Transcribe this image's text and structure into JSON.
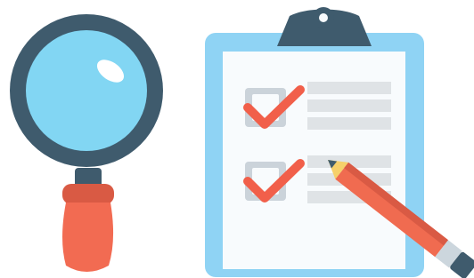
{
  "illustration": {
    "magnifier": {
      "icon": "magnifying-glass"
    },
    "clipboard": {
      "icon": "clipboard",
      "checkboxes": [
        {
          "icon": "checkmark",
          "checked": true
        },
        {
          "icon": "checkmark",
          "checked": true
        }
      ]
    },
    "pencil": {
      "icon": "pencil"
    }
  },
  "colors": {
    "background": "#ffffff",
    "lens_fill": "#82d6f3",
    "frame_dark": "#3f5b6d",
    "handle_orange": "#f26b52",
    "handle_dark_orange": "#d95a44",
    "clipboard_border": "#8fd3f4",
    "paper": "#f8fbfd",
    "line_gray": "#dfe3e6",
    "check_red": "#f15f4a",
    "check_box": "#cbd3da",
    "pencil_yellow": "#f6d06a",
    "pencil_body": "#f06b50",
    "pencil_end": "#ccd6dd",
    "pencil_tip": "#3f5b6d"
  }
}
